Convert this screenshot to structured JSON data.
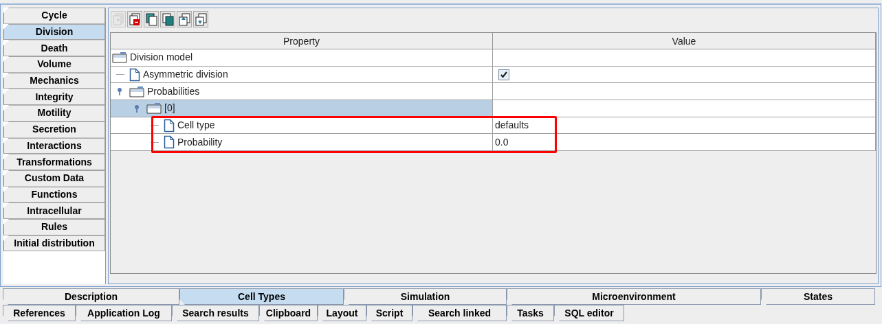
{
  "side_tabs": [
    {
      "label": "Cycle",
      "selected": false
    },
    {
      "label": "Division",
      "selected": true
    },
    {
      "label": "Death",
      "selected": false
    },
    {
      "label": "Volume",
      "selected": false
    },
    {
      "label": "Mechanics",
      "selected": false
    },
    {
      "label": "Integrity",
      "selected": false
    },
    {
      "label": "Motility",
      "selected": false
    },
    {
      "label": "Secretion",
      "selected": false
    },
    {
      "label": "Interactions",
      "selected": false
    },
    {
      "label": "Transformations",
      "selected": false
    },
    {
      "label": "Custom Data",
      "selected": false
    },
    {
      "label": "Functions",
      "selected": false
    },
    {
      "label": "Intracellular",
      "selected": false
    },
    {
      "label": "Rules",
      "selected": false
    },
    {
      "label": "Initial distribution",
      "selected": false
    }
  ],
  "toolbar": [
    {
      "kind": "add",
      "disabled": true
    },
    {
      "kind": "remove",
      "disabled": false
    },
    {
      "kind": "copy",
      "disabled": false
    },
    {
      "kind": "duplicate",
      "disabled": false
    },
    {
      "kind": "up",
      "disabled": false
    },
    {
      "kind": "down",
      "disabled": false
    }
  ],
  "table": {
    "columns": [
      "Property",
      "Value"
    ],
    "tree": [
      {
        "label": "Division model",
        "kind": "folder",
        "selected": false,
        "children": [
          {
            "label": "Asymmetric division",
            "kind": "leaf",
            "selected": false,
            "value": {
              "kind": "checkbox",
              "checked": true
            }
          },
          {
            "label": "Probabilities",
            "kind": "folder",
            "selected": false,
            "expanded": true,
            "children": [
              {
                "label": "[0]",
                "kind": "folder",
                "selected": true,
                "expanded": true,
                "children": [
                  {
                    "label": "Cell type",
                    "kind": "leaf",
                    "selected": false,
                    "highlighted": true,
                    "value": {
                      "kind": "text",
                      "text": "defaults"
                    }
                  },
                  {
                    "label": "Probability",
                    "kind": "leaf",
                    "selected": false,
                    "highlighted": true,
                    "value": {
                      "kind": "text",
                      "text": "0.0"
                    }
                  }
                ]
              }
            ]
          }
        ]
      }
    ]
  },
  "bottom_tabs": [
    [
      {
        "label": "Description",
        "selected": false
      },
      {
        "label": "Cell Types",
        "selected": true
      },
      {
        "label": "Simulation",
        "selected": false
      },
      {
        "label": "Microenvironment",
        "selected": false
      },
      {
        "label": "States",
        "selected": false
      }
    ],
    [
      {
        "label": "References",
        "selected": false
      },
      {
        "label": "Application Log",
        "selected": false
      },
      {
        "label": "Search results",
        "selected": false
      },
      {
        "label": "Clipboard",
        "selected": false
      },
      {
        "label": "Layout",
        "selected": false
      },
      {
        "label": "Script",
        "selected": false
      },
      {
        "label": "Search linked",
        "selected": false
      },
      {
        "label": "Tasks",
        "selected": false
      },
      {
        "label": "SQL editor",
        "selected": false
      }
    ]
  ]
}
